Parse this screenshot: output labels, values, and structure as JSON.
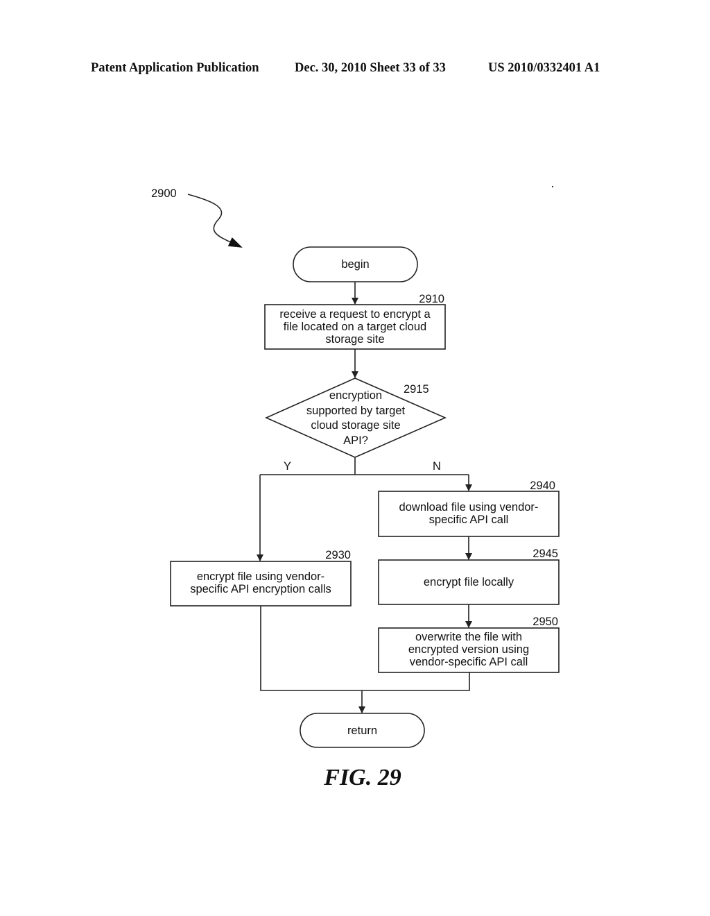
{
  "header": {
    "left": "Patent Application Publication",
    "middle": "Dec. 30, 2010   Sheet 33 of 33",
    "right": "US 2010/0332401 A1"
  },
  "figure": {
    "ref": "2900",
    "caption": "FIG. 29"
  },
  "nodes": {
    "begin": {
      "label": "begin"
    },
    "n2910": {
      "ref": "2910",
      "lines": [
        "receive a request to encrypt a",
        "file located on a target cloud",
        "storage site"
      ]
    },
    "n2915": {
      "ref": "2915",
      "lines": [
        "encryption",
        "supported by target",
        "cloud storage site",
        "API?"
      ]
    },
    "n2930": {
      "ref": "2930",
      "lines": [
        "encrypt file using vendor-",
        "specific API encryption calls"
      ]
    },
    "n2940": {
      "ref": "2940",
      "lines": [
        "download file using vendor-",
        "specific API call"
      ]
    },
    "n2945": {
      "ref": "2945",
      "lines": [
        "encrypt file locally"
      ]
    },
    "n2950": {
      "ref": "2950",
      "lines": [
        "overwrite the file with",
        "encrypted version using",
        "vendor-specific API call"
      ]
    },
    "return": {
      "label": "return"
    }
  },
  "branches": {
    "yes": "Y",
    "no": "N"
  }
}
